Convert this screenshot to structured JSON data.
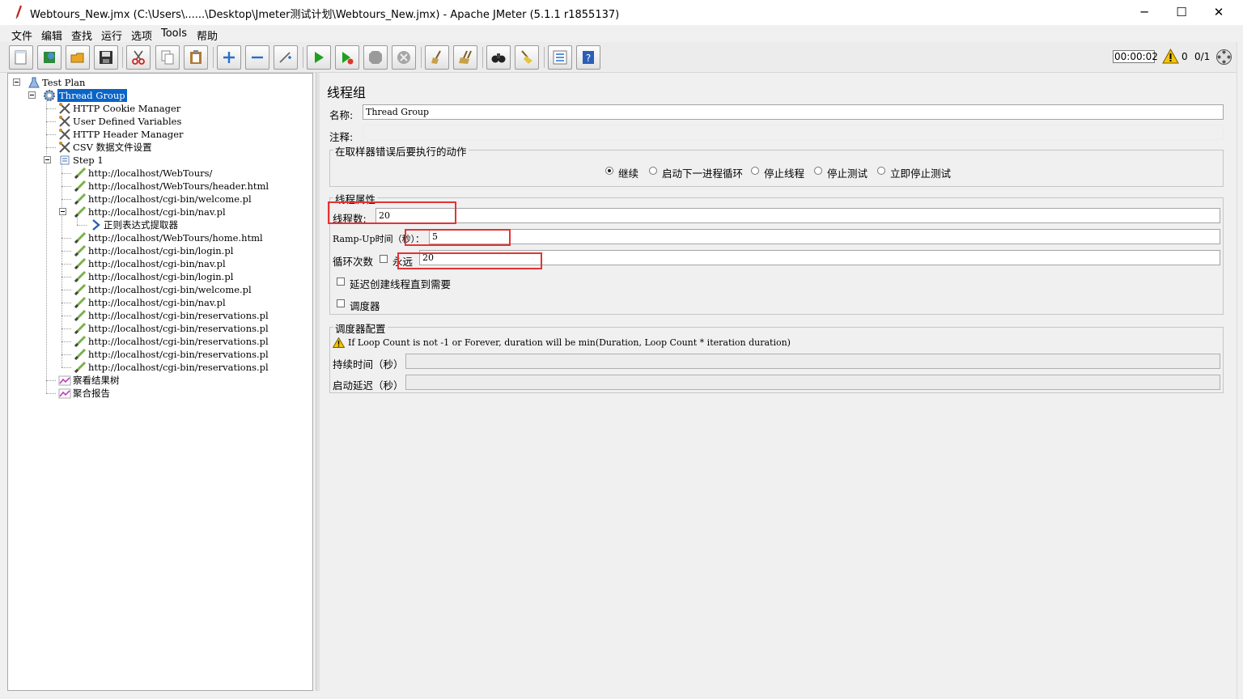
{
  "window": {
    "title": "Webtours_New.jmx (C:\\Users\\......\\Desktop\\Jmeter测试计划\\Webtours_New.jmx) - Apache JMeter (5.1.1 r1855137)",
    "minimize": "─",
    "maximize": "☐",
    "close": "✕"
  },
  "menu": [
    "文件",
    "编辑",
    "查找",
    "运行",
    "选项",
    "Tools",
    "帮助"
  ],
  "toolbar": {
    "timer": "00:00:02",
    "warnings": "0",
    "threads": "0/1"
  },
  "tree": [
    {
      "label": "Test Plan",
      "icon": "test-plan-icon"
    },
    {
      "label": "Thread Group",
      "icon": "thread-group-gear-icon",
      "selected": true
    },
    {
      "label": "HTTP Cookie Manager",
      "icon": "config-element-icon"
    },
    {
      "label": "User Defined Variables",
      "icon": "config-element-icon"
    },
    {
      "label": "HTTP Header Manager",
      "icon": "config-element-icon"
    },
    {
      "label": "CSV 数据文件设置",
      "icon": "config-element-icon"
    },
    {
      "label": "Step 1",
      "icon": "transaction-controller-icon"
    },
    {
      "label": "http://localhost/WebTours/",
      "icon": "http-sampler-icon"
    },
    {
      "label": "http://localhost/WebTours/header.html",
      "icon": "http-sampler-icon"
    },
    {
      "label": "http://localhost/cgi-bin/welcome.pl",
      "icon": "http-sampler-icon"
    },
    {
      "label": "http://localhost/cgi-bin/nav.pl",
      "icon": "http-sampler-icon"
    },
    {
      "label": "正则表达式提取器",
      "icon": "post-processor-arrow-icon"
    },
    {
      "label": "http://localhost/WebTours/home.html",
      "icon": "http-sampler-icon"
    },
    {
      "label": "http://localhost/cgi-bin/login.pl",
      "icon": "http-sampler-icon"
    },
    {
      "label": "http://localhost/cgi-bin/nav.pl",
      "icon": "http-sampler-icon"
    },
    {
      "label": "http://localhost/cgi-bin/login.pl",
      "icon": "http-sampler-icon"
    },
    {
      "label": "http://localhost/cgi-bin/welcome.pl",
      "icon": "http-sampler-icon"
    },
    {
      "label": "http://localhost/cgi-bin/nav.pl",
      "icon": "http-sampler-icon"
    },
    {
      "label": "http://localhost/cgi-bin/reservations.pl",
      "icon": "http-sampler-icon"
    },
    {
      "label": "http://localhost/cgi-bin/reservations.pl",
      "icon": "http-sampler-icon"
    },
    {
      "label": "http://localhost/cgi-bin/reservations.pl",
      "icon": "http-sampler-icon"
    },
    {
      "label": "http://localhost/cgi-bin/reservations.pl",
      "icon": "http-sampler-icon"
    },
    {
      "label": "http://localhost/cgi-bin/reservations.pl",
      "icon": "http-sampler-icon"
    },
    {
      "label": "察看结果树",
      "icon": "listener-graph-icon"
    },
    {
      "label": "聚合报告",
      "icon": "listener-graph-icon"
    }
  ],
  "panel": {
    "heading": "线程组",
    "name_label": "名称:",
    "name_value": "Thread Group",
    "comment_label": "注释:",
    "comment_value": "",
    "error_group_title": "在取样器错误后要执行的动作",
    "error_options": [
      "继续",
      "启动下一进程循环",
      "停止线程",
      "停止测试",
      "立即停止测试"
    ],
    "error_selected": "继续",
    "thread_group_title": "线程属性",
    "threads_label": "线程数:",
    "threads_value": "20",
    "rampup_label": "Ramp-Up时间（秒）：",
    "rampup_value": "5",
    "loop_label": "循环次数",
    "forever_label": "永远",
    "loop_value": "20",
    "delay_label": "延迟创建线程直到需要",
    "scheduler_label": "调度器",
    "scheduler_group_title": "调度器配置",
    "scheduler_note": "If Loop Count is not -1 or Forever, duration will be min(Duration, Loop Count * iteration duration)",
    "duration_label": "持续时间（秒）",
    "duration_value": "",
    "startup_delay_label": "启动延迟（秒）",
    "startup_delay_value": ""
  },
  "colors": {
    "selection": "#0a64c8",
    "highlight_box": "#e33434",
    "run_green": "#1ea01e"
  }
}
